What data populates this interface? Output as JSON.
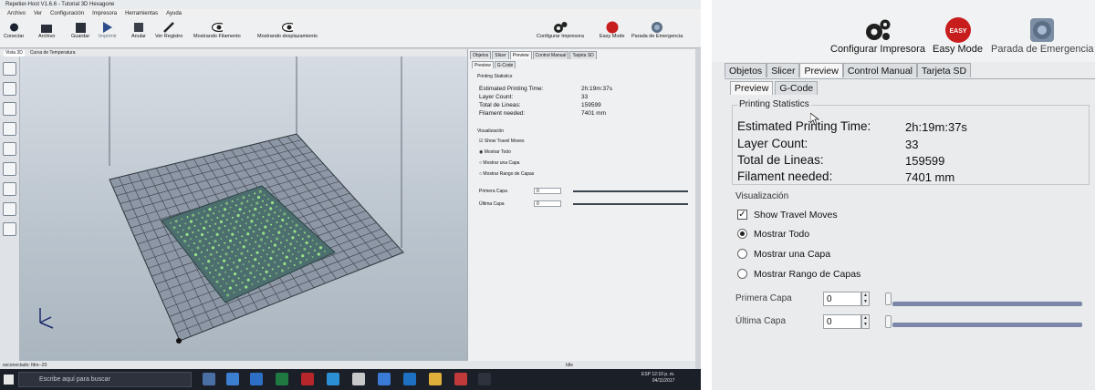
{
  "window": {
    "title": "Repetier-Host V1.6.6 - Tutorial 3D Hexagone"
  },
  "menu": [
    "Archivo",
    "Ver",
    "Configuración",
    "Impresora",
    "Herramientas",
    "Ayuda"
  ],
  "toolbar": {
    "buttons": [
      "Conectar",
      "Archivo",
      "Guardar",
      "Imprimir",
      "Anular",
      "Ver Registro",
      "Mostrando Filamento",
      "Mostrando desplazamiento"
    ],
    "right_buttons": [
      "Configurar Impresora",
      "Easy Mode",
      "Parada de Emergencia"
    ],
    "easy_badge": "EASY"
  },
  "view_tabs": [
    "Vista 3D",
    "Curva de Temperatura"
  ],
  "panel": {
    "tabs": [
      "Objetos",
      "Slicer",
      "Preview",
      "Control Manual",
      "Tarjeta SD"
    ],
    "active_tab": "Preview",
    "subtabs": [
      "Preview",
      "G-Code"
    ],
    "active_subtab": "Preview",
    "stats_title": "Printing Statistics",
    "stats": [
      {
        "label": "Estimated Printing Time:",
        "value": "2h:19m:37s"
      },
      {
        "label": "Layer Count:",
        "value": "33"
      },
      {
        "label": "Total de Lineas:",
        "value": "159599"
      },
      {
        "label": "Filament needed:",
        "value": "7401 mm"
      }
    ],
    "visualization_title": "Visualización",
    "show_travel": {
      "label": "Show Travel Moves",
      "checked": true
    },
    "radio_options": [
      "Mostrar Todo",
      "Mostrar una Capa",
      "Mostrar Rango de Capas"
    ],
    "radio_selected": "Mostrar Todo",
    "first_layer": {
      "label": "Primera Capa",
      "value": "0"
    },
    "last_layer": {
      "label": "Última Capa",
      "value": "0"
    }
  },
  "status": {
    "left": "esconectado: fdm--20",
    "mid": "Idle"
  },
  "taskbar": {
    "search_placeholder": "Escribe aquí para buscar",
    "time": "12:10 p. m.",
    "date": "04/11/2017",
    "lang": "ESP"
  },
  "colors": {
    "bed_grid": "#3c4048",
    "bed_fill": "#8d97a6",
    "model": "#4d6e6e",
    "model_highlight": "#9ff08a",
    "easy_red": "#c81d1d",
    "slider": "#7b86a8"
  }
}
